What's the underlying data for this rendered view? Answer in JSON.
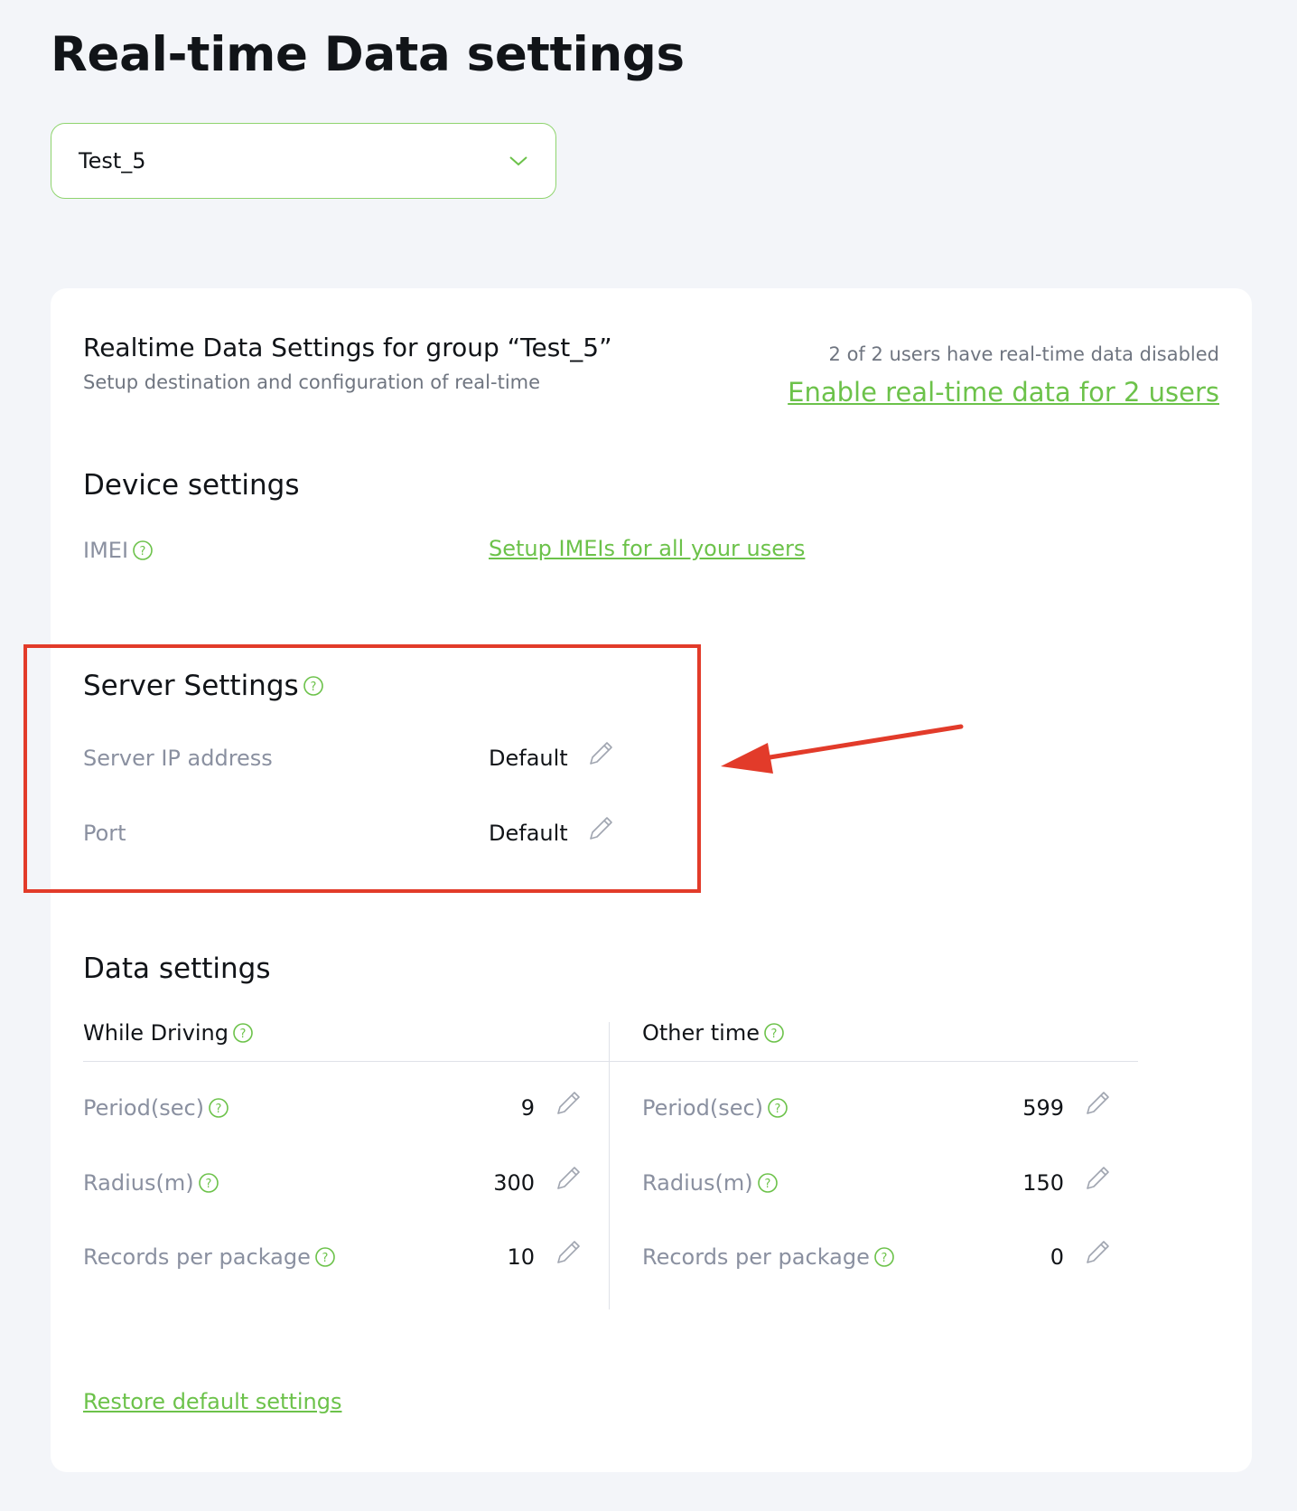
{
  "page": {
    "title": "Real-time Data settings"
  },
  "group_select": {
    "value": "Test_5"
  },
  "card": {
    "title": "Realtime Data Settings for group “Test_5”",
    "subtitle": "Setup destination and configuration of real-time",
    "status": "2 of 2 users have real-time data disabled",
    "enable_link": "Enable real-time data for 2 users"
  },
  "device_settings": {
    "title": "Device settings",
    "imei_label": "IMEI",
    "imei_link": "Setup IMEIs for all your users"
  },
  "server_settings": {
    "title": "Server Settings",
    "ip_label": "Server IP address",
    "ip_value": "Default",
    "port_label": "Port",
    "port_value": "Default"
  },
  "data_settings": {
    "title": "Data settings",
    "while_driving": {
      "heading": "While Driving",
      "period_label": "Period(sec)",
      "period_value": "9",
      "radius_label": "Radius(m)",
      "radius_value": "300",
      "records_label": "Records per package",
      "records_value": "10"
    },
    "other_time": {
      "heading": "Other time",
      "period_label": "Period(sec)",
      "period_value": "599",
      "radius_label": "Radius(m)",
      "radius_value": "150",
      "records_label": "Records per package",
      "records_value": "0"
    }
  },
  "restore_link": "Restore default settings",
  "colors": {
    "accent": "#6cc24a",
    "annotation": "#e23b2a",
    "muted": "#8a90a0"
  },
  "icons": {
    "help": "help-circle-icon",
    "edit": "pencil-icon",
    "dropdown": "chevron-down-icon"
  }
}
